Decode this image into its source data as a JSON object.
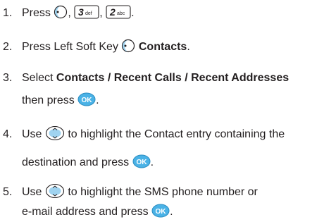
{
  "steps": [
    {
      "number": "1.",
      "press_word": "Press",
      "sep1": ",",
      "sep2": ",",
      "end": ".",
      "icons": [
        "left-soft-key-icon",
        "key-3-def-icon",
        "key-2-abc-icon"
      ],
      "key3_digit": "3",
      "key3_letters": "def",
      "key2_digit": "2",
      "key2_letters": "abc"
    },
    {
      "number": "2.",
      "text_before": "Press Left Soft Key",
      "icon": "left-soft-key-icon",
      "bold_text": "Contacts",
      "end": "."
    },
    {
      "number": "3.",
      "line1_before": "Select ",
      "line1_bold": "Contacts / Recent Calls / Recent Addresses",
      "line2_before": "then press",
      "icon": "ok-key-icon",
      "ok_label": "OK",
      "end": "."
    },
    {
      "number": "4.",
      "line1_before": "Use",
      "icon_nav": "navigation-key-icon",
      "line1_after": "to highlight the Contact entry containing the",
      "line2_before": "destination and press",
      "icon_ok": "ok-key-icon",
      "ok_label": "OK",
      "end": "."
    },
    {
      "number": "5.",
      "line1_before": "Use",
      "icon_nav": "navigation-key-icon",
      "line1_after": "to highlight the SMS phone number or",
      "line2_before": "e-mail address and press",
      "icon_ok": "ok-key-icon",
      "ok_label": "OK",
      "end": "."
    }
  ],
  "colors": {
    "text": "#231f20",
    "key_fill": "#9fd3f0",
    "ok_fill": "#4ab2e6",
    "key_border": "#231f20"
  }
}
